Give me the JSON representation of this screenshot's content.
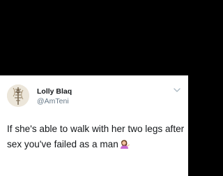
{
  "tweet": {
    "display_name": "Lolly Blaq",
    "handle": "@AmTeni",
    "text": "If she's able to walk with her two legs after sex you've failed as a man",
    "emoji_icon": "woman-tipping-hand-emoji-icon",
    "menu_icon": "chevron-down-icon"
  },
  "colors": {
    "background_top": "#000000",
    "card": "#ffffff",
    "name": "#14171a",
    "handle": "#657786"
  }
}
